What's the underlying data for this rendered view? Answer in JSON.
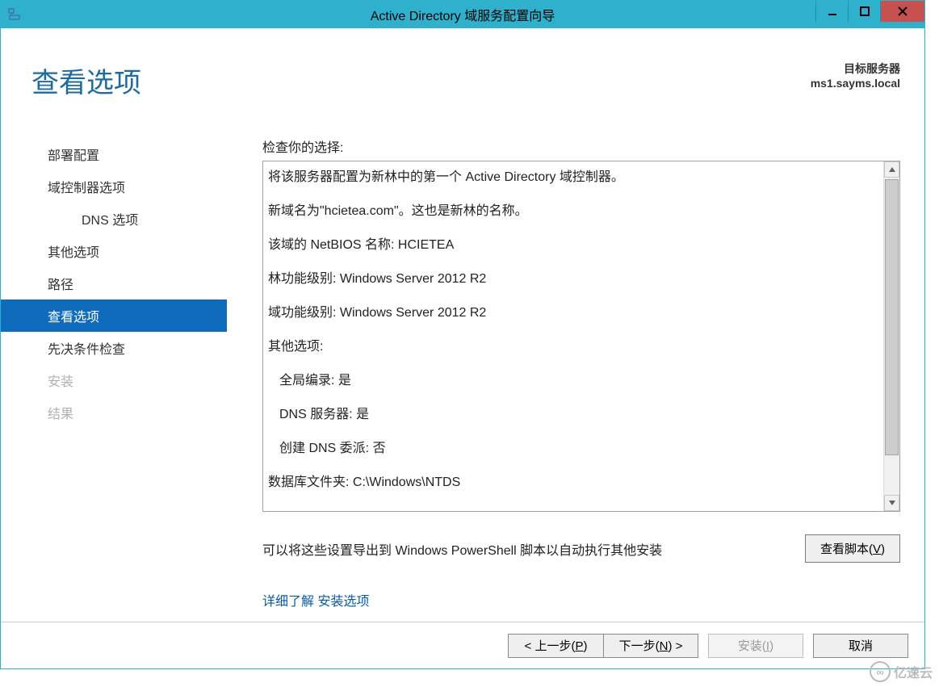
{
  "window": {
    "title": "Active Directory 域服务配置向导"
  },
  "header": {
    "heading": "查看选项",
    "target_label": "目标服务器",
    "target_value": "ms1.sayms.local"
  },
  "nav": {
    "items": [
      {
        "label": "部署配置",
        "indent": false,
        "selected": false,
        "disabled": false
      },
      {
        "label": "域控制器选项",
        "indent": false,
        "selected": false,
        "disabled": false
      },
      {
        "label": "DNS 选项",
        "indent": true,
        "selected": false,
        "disabled": false
      },
      {
        "label": "其他选项",
        "indent": false,
        "selected": false,
        "disabled": false
      },
      {
        "label": "路径",
        "indent": false,
        "selected": false,
        "disabled": false
      },
      {
        "label": "查看选项",
        "indent": false,
        "selected": true,
        "disabled": false
      },
      {
        "label": "先决条件检查",
        "indent": false,
        "selected": false,
        "disabled": false
      },
      {
        "label": "安装",
        "indent": false,
        "selected": false,
        "disabled": true
      },
      {
        "label": "结果",
        "indent": false,
        "selected": false,
        "disabled": true
      }
    ]
  },
  "review": {
    "label": "检查你的选择:",
    "lines": [
      "将该服务器配置为新林中的第一个 Active Directory 域控制器。",
      "新域名为\"hcietea.com\"。这也是新林的名称。",
      "该域的 NetBIOS 名称: HCIETEA",
      "林功能级别: Windows Server 2012 R2",
      "域功能级别: Windows Server 2012 R2",
      "其他选项:",
      "全局编录: 是",
      "DNS 服务器: 是",
      "创建 DNS 委派: 否",
      "数据库文件夹: C:\\Windows\\NTDS"
    ],
    "indented_indices": [
      6,
      7,
      8
    ]
  },
  "export": {
    "text": "可以将这些设置导出到 Windows PowerShell 脚本以自动执行其他安装",
    "button_prefix": "查看脚本(",
    "button_hotkey": "V",
    "button_suffix": ")"
  },
  "links": {
    "learn": "详细了解",
    "topic": "安装选项"
  },
  "footer": {
    "prev_prefix": "< 上一步(",
    "prev_hotkey": "P",
    "prev_suffix": ")",
    "next_prefix": "下一步(",
    "next_hotkey": "N",
    "next_suffix": ") >",
    "install_prefix": "安装(",
    "install_hotkey": "I",
    "install_suffix": ")",
    "cancel": "取消"
  },
  "watermark": "亿速云"
}
